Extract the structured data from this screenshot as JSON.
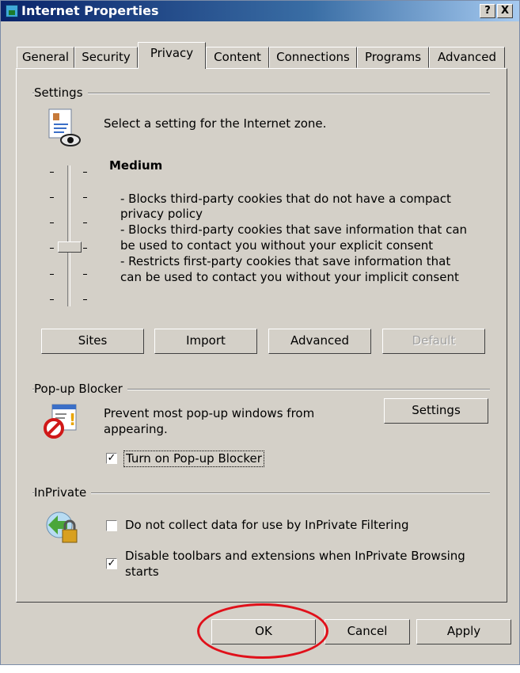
{
  "window": {
    "title": "Internet Properties",
    "help_label": "?",
    "close_label": "X"
  },
  "tabs": [
    {
      "label": "General"
    },
    {
      "label": "Security"
    },
    {
      "label": "Privacy"
    },
    {
      "label": "Content"
    },
    {
      "label": "Connections"
    },
    {
      "label": "Programs"
    },
    {
      "label": "Advanced"
    }
  ],
  "settings": {
    "group_label": "Settings",
    "intro": "Select a setting for the Internet zone.",
    "level_title": "Medium",
    "level_lines": [
      "- Blocks third-party cookies that do not have a compact",
      "privacy policy",
      "- Blocks third-party cookies that save information that can",
      "be used to contact you without your explicit consent",
      "- Restricts first-party cookies that save information that",
      "can be used to contact you without your implicit consent"
    ],
    "slider_level": "3 of 6 (Medium)",
    "buttons": {
      "sites": "Sites",
      "import": "Import",
      "advanced": "Advanced",
      "default": "Default"
    }
  },
  "popup": {
    "group_label": "Pop-up Blocker",
    "desc_line1": "Prevent most pop-up windows from",
    "desc_line2": "appearing.",
    "settings_button": "Settings",
    "checkbox_label": "Turn on Pop-up Blocker",
    "checkbox_checked": true
  },
  "inprivate": {
    "group_label": "InPrivate",
    "filter_label": "Do not collect data for use by InPrivate Filtering",
    "filter_checked": false,
    "toolbar_label_line1": "Disable toolbars and extensions when InPrivate Browsing",
    "toolbar_label_line2": "starts",
    "toolbar_checked": true
  },
  "footer": {
    "ok": "OK",
    "cancel": "Cancel",
    "apply": "Apply"
  },
  "colors": {
    "dialog_bg": "#d4d0c8",
    "title_start": "#0a246a",
    "annotation_ring": "#e0101a"
  },
  "icons": [
    "internet-options-icon",
    "privacy-document-eye-icon",
    "popup-blocker-icon",
    "inprivate-lock-icon"
  ]
}
